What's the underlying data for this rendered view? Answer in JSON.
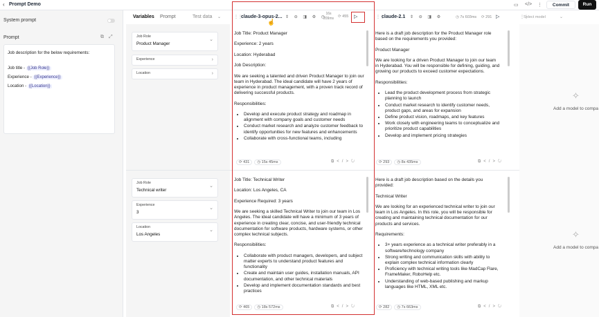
{
  "app": {
    "title": "Prompt Demo",
    "commit_label": "Commit",
    "run_label": "Run"
  },
  "left": {
    "system_prompt_label": "System prompt",
    "prompt_label": "Prompt",
    "prompt_lines": [
      {
        "text": "Job description for the below requirements:"
      },
      {
        "prefix": "Job title - ",
        "var": "{{Job Role}}"
      },
      {
        "prefix": "Experience - ",
        "var": "{{Experience}}"
      },
      {
        "prefix": "Location - ",
        "var": "{{Location}}"
      }
    ]
  },
  "tabs": {
    "variables": "Variables",
    "prompt": "Prompt",
    "test_data": "Test data"
  },
  "rows": [
    {
      "job_role_label": "Job Role",
      "job_role": "Product Manager",
      "experience_label": "Experience",
      "experience": "",
      "location_label": "Location",
      "location": ""
    },
    {
      "job_role_label": "Job Role",
      "job_role": "Technical writer",
      "experience_label": "Experience",
      "experience": "3",
      "location_label": "Location",
      "location": "Los Angeles"
    }
  ],
  "columns": [
    {
      "model": "claude-3-opus-2...",
      "tokens": "16s",
      "time": "209ms",
      "extra": "455"
    },
    {
      "model": "claude-2.1",
      "time": "7s 603ms",
      "tokens": "291"
    },
    {
      "model": "Select model"
    }
  ],
  "responses": {
    "opus_pm": {
      "p1": "Job Title: Product Manager",
      "p2": "Experience: 2 years",
      "p3": "Location: Hyderabad",
      "p4": "Job Description:",
      "p5": "We are seeking a talented and driven Product Manager to join our team in Hyderabad. The ideal candidate will have 2 years of experience in product management, with a proven track record of delivering successful products.",
      "p6": "Responsibilities:",
      "li1": "Develop and execute product strategy and roadmap in alignment with company goals and customer needs",
      "li2": "Conduct market research and analyze customer feedback to identify opportunities for new features and enhancements",
      "li3": "Collaborate with cross-functional teams, including",
      "tokens": "431",
      "time": "15s 45ms"
    },
    "c21_pm": {
      "p1": "Here is a draft job description for the Product Manager role based on the requirements you provided:",
      "p2": "Product Manager",
      "p3": "We are looking for a driven Product Manager to join our team in Hyderabad. You will be responsible for defining, guiding, and growing our products to exceed customer expectations.",
      "p4": "Responsibilities:",
      "li1": "Lead the product development process from strategic planning to launch",
      "li2": "Conduct market research to identify customer needs, product gaps, and areas for expansion",
      "li3": "Define product vision, roadmaps, and key features",
      "li4": "Work closely with engineering teams to conceptualize and prioritize product capabilities",
      "li5": "Develop and implement pricing strategies",
      "tokens": "293",
      "time": "8s 435ms"
    },
    "opus_tw": {
      "p1": "Job Title: Technical Writer",
      "p2": "Location: Los Angeles, CA",
      "p3": "Experience Required: 3 years",
      "p4": "We are seeking a skilled Technical Writer to join our team in Los Angeles. The ideal candidate will have a minimum of 3 years of experience in creating clear, concise, and user-friendly technical documentation for software products, hardware systems, or other complex technical subjects.",
      "p5": "Responsibilities:",
      "li1": "Collaborate with product managers, developers, and subject matter experts to understand product features and functionality",
      "li2": "Create and maintain user guides, installation manuals, API documentation, and other technical materials",
      "li3": "Develop and implement documentation standards and best practices",
      "tokens": "465",
      "time": "18s 572ms"
    },
    "c21_tw": {
      "p1": "Here is a draft job description based on the details you provided:",
      "p2": "Technical Writer",
      "p3": "We are looking for an experienced technical writer to join our team in Los Angeles. In this role, you will be responsible for creating and maintaining technical documentation for our products and services.",
      "p4": "Requirements:",
      "li1": "3+ years experience as a technical writer preferably in a software/technology company",
      "li2": "Strong writing and communication skills with ability to explain complex technical information clearly",
      "li3": "Proficiency with technical writing tools like MadCap Flare, FrameMaker, RoboHelp etc.",
      "li4": "Understanding of web-based publishing and markup languages like HTML, XML etc.",
      "tokens": "282",
      "time": "7s 663ms"
    }
  },
  "add_model_text": "Add a model to compa"
}
